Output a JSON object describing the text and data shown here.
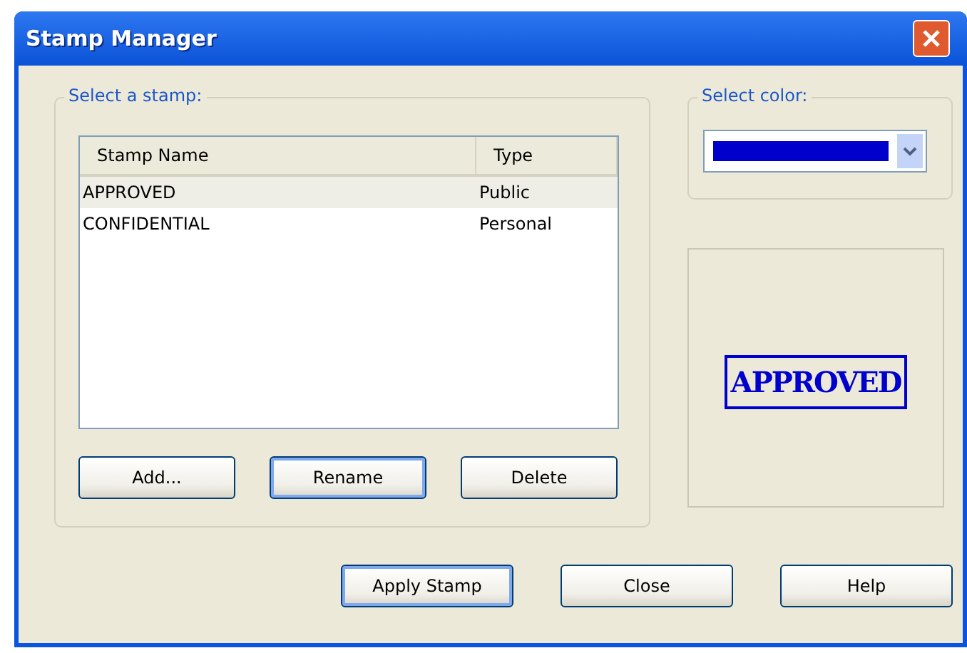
{
  "window": {
    "title": "Stamp Manager"
  },
  "stamp_group": {
    "label": "Select a stamp:",
    "columns": [
      "Stamp Name",
      "Type"
    ],
    "rows": [
      {
        "name": "APPROVED",
        "type": "Public",
        "selected": true
      },
      {
        "name": "CONFIDENTIAL",
        "type": "Personal",
        "selected": false
      }
    ],
    "buttons": [
      {
        "label": "Add...",
        "focused": false
      },
      {
        "label": "Rename",
        "focused": true
      },
      {
        "label": "Delete",
        "focused": false
      }
    ]
  },
  "color_group": {
    "label": "Select color:",
    "color": "#0000cc"
  },
  "preview": {
    "text": "APPROVED"
  },
  "buttons": [
    {
      "label": "Apply Stamp",
      "focused": true
    },
    {
      "label": "Close",
      "focused": false
    },
    {
      "label": "Help",
      "focused": false
    }
  ]
}
